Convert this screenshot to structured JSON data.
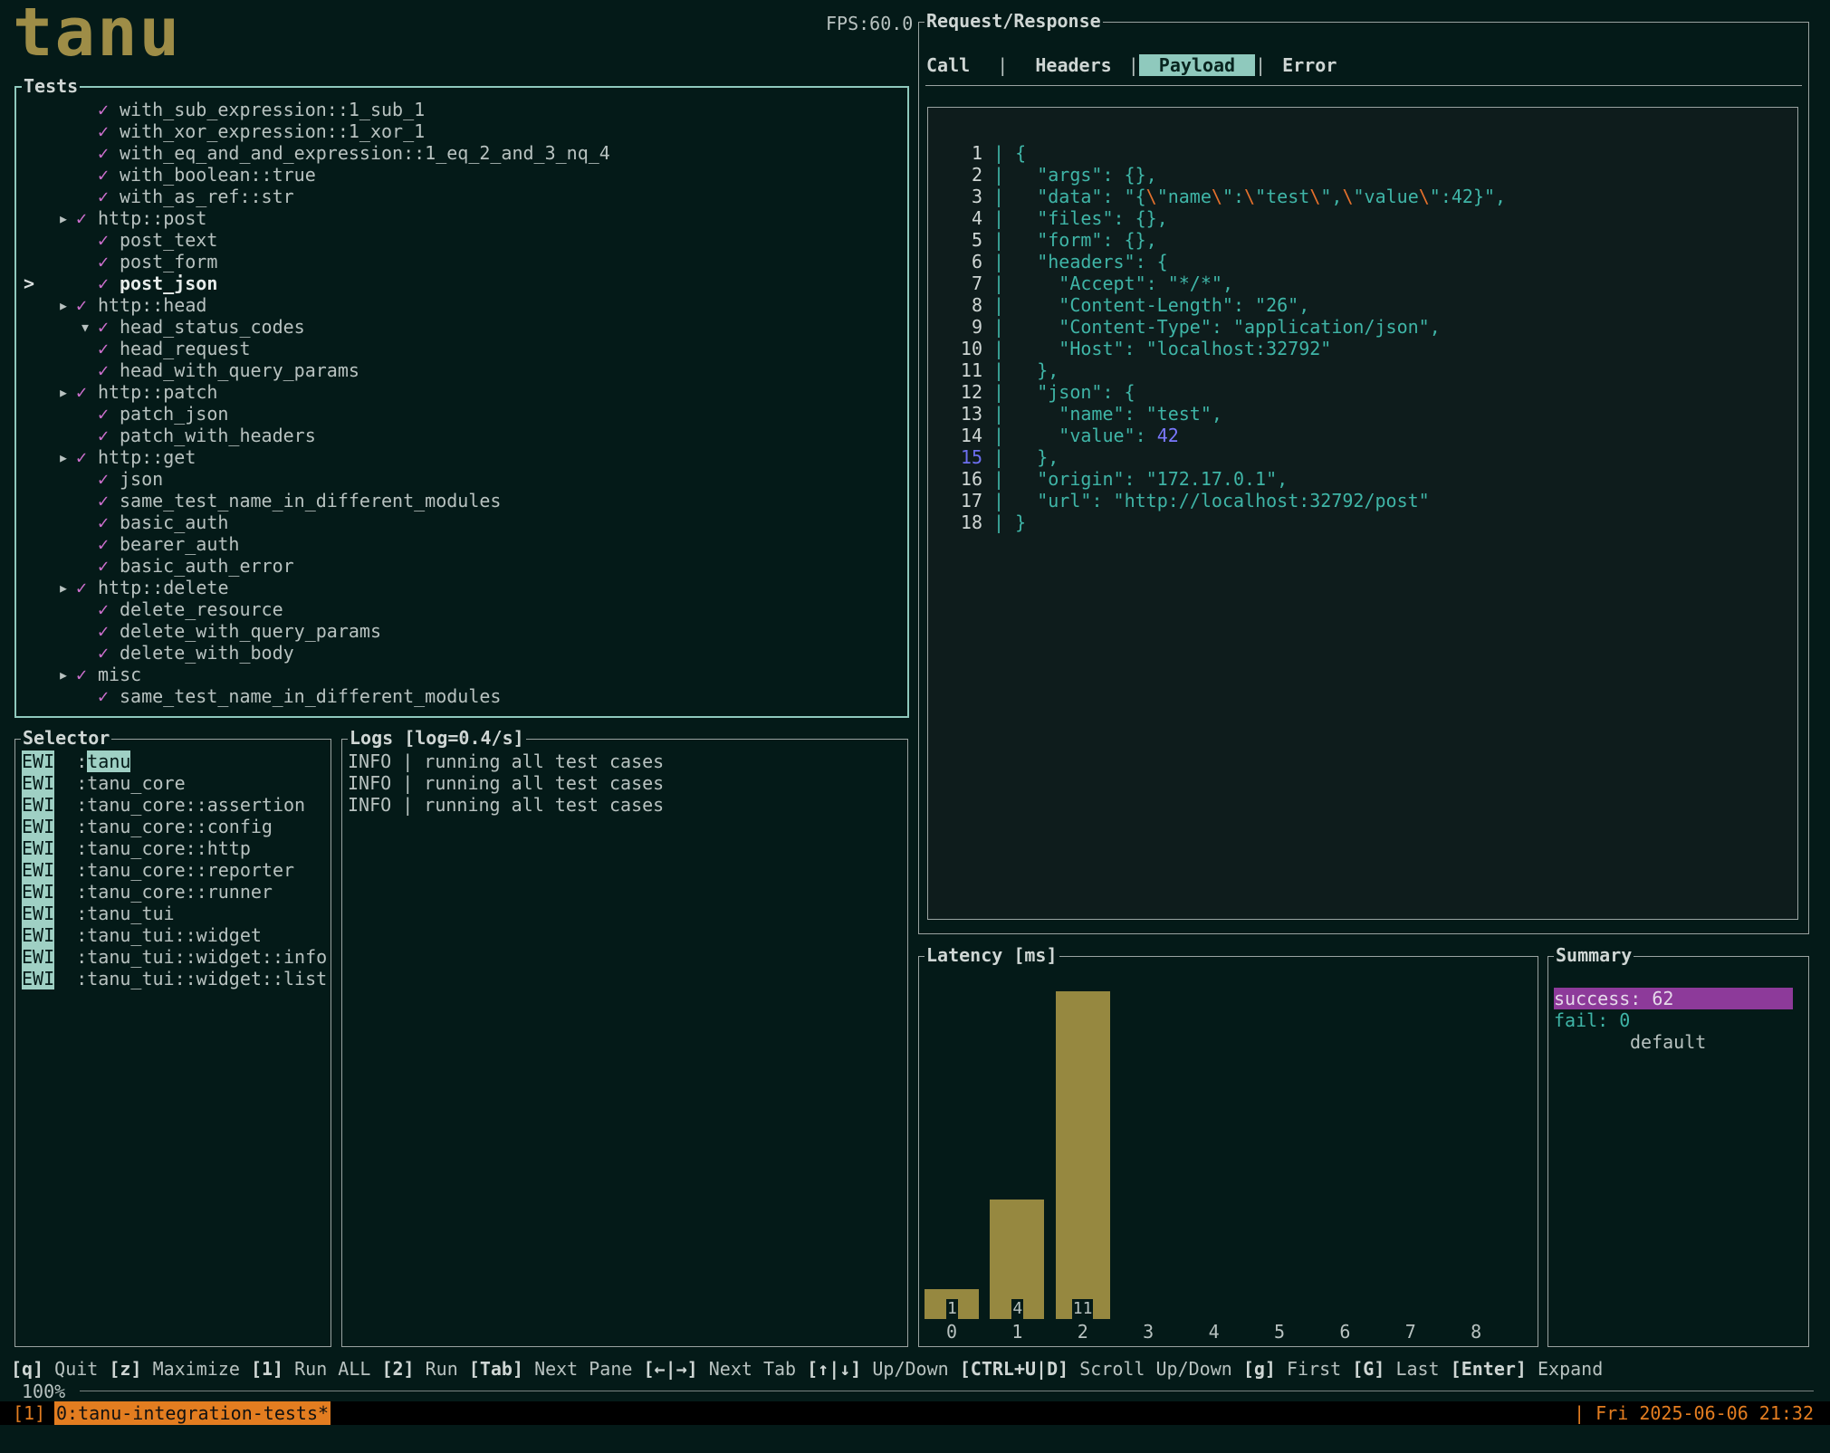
{
  "app": {
    "logo": "tanu",
    "fps": "FPS:60.0"
  },
  "tests": {
    "title": "Tests",
    "rows": [
      {
        "indent": 2,
        "caret": "",
        "check": "✓",
        "label": "with_sub_expression::1_sub_1"
      },
      {
        "indent": 2,
        "caret": "",
        "check": "✓",
        "label": "with_xor_expression::1_xor_1"
      },
      {
        "indent": 2,
        "caret": "",
        "check": "✓",
        "label": "with_eq_and_and_expression::1_eq_2_and_3_nq_4"
      },
      {
        "indent": 2,
        "caret": "",
        "check": "✓",
        "label": "with_boolean::true"
      },
      {
        "indent": 2,
        "caret": "",
        "check": "✓",
        "label": "with_as_ref::str"
      },
      {
        "indent": 1,
        "caret": "▸",
        "check": "✓",
        "label": "http::post"
      },
      {
        "indent": 2,
        "caret": "",
        "check": "✓",
        "label": "post_text"
      },
      {
        "indent": 2,
        "caret": "",
        "check": "✓",
        "label": "post_form"
      },
      {
        "indent": 2,
        "caret": "",
        "check": "✓",
        "label": "post_json",
        "selected": true,
        "marker": ">"
      },
      {
        "indent": 1,
        "caret": "▸",
        "check": "✓",
        "label": "http::head"
      },
      {
        "indent": 2,
        "caret": "▾",
        "check": "✓",
        "label": "head_status_codes"
      },
      {
        "indent": 2,
        "caret": "",
        "check": "✓",
        "label": "head_request"
      },
      {
        "indent": 2,
        "caret": "",
        "check": "✓",
        "label": "head_with_query_params"
      },
      {
        "indent": 1,
        "caret": "▸",
        "check": "✓",
        "label": "http::patch"
      },
      {
        "indent": 2,
        "caret": "",
        "check": "✓",
        "label": "patch_json"
      },
      {
        "indent": 2,
        "caret": "",
        "check": "✓",
        "label": "patch_with_headers"
      },
      {
        "indent": 1,
        "caret": "▸",
        "check": "✓",
        "label": "http::get"
      },
      {
        "indent": 2,
        "caret": "",
        "check": "✓",
        "label": "json"
      },
      {
        "indent": 2,
        "caret": "",
        "check": "✓",
        "label": "same_test_name_in_different_modules"
      },
      {
        "indent": 2,
        "caret": "",
        "check": "✓",
        "label": "basic_auth"
      },
      {
        "indent": 2,
        "caret": "",
        "check": "✓",
        "label": "bearer_auth"
      },
      {
        "indent": 2,
        "caret": "",
        "check": "✓",
        "label": "basic_auth_error"
      },
      {
        "indent": 1,
        "caret": "▸",
        "check": "✓",
        "label": "http::delete"
      },
      {
        "indent": 2,
        "caret": "",
        "check": "✓",
        "label": "delete_resource"
      },
      {
        "indent": 2,
        "caret": "",
        "check": "✓",
        "label": "delete_with_query_params"
      },
      {
        "indent": 2,
        "caret": "",
        "check": "✓",
        "label": "delete_with_body"
      },
      {
        "indent": 1,
        "caret": "▸",
        "check": "✓",
        "label": "misc"
      },
      {
        "indent": 2,
        "caret": "",
        "check": "✓",
        "label": "same_test_name_in_different_modules"
      }
    ]
  },
  "selector": {
    "title": "Selector",
    "badge": "EWI",
    "items": [
      {
        "prefix": ":",
        "name": "tanu",
        "highlight": true
      },
      {
        "prefix": ":",
        "name": "tanu_core"
      },
      {
        "prefix": ":",
        "name": "tanu_core::assertion"
      },
      {
        "prefix": ":",
        "name": "tanu_core::config"
      },
      {
        "prefix": ":",
        "name": "tanu_core::http"
      },
      {
        "prefix": ":",
        "name": "tanu_core::reporter"
      },
      {
        "prefix": ":",
        "name": "tanu_core::runner"
      },
      {
        "prefix": ":",
        "name": "tanu_tui"
      },
      {
        "prefix": ":",
        "name": "tanu_tui::widget"
      },
      {
        "prefix": ":",
        "name": "tanu_tui::widget::info"
      },
      {
        "prefix": ":",
        "name": "tanu_tui::widget::list"
      }
    ]
  },
  "logs": {
    "title": "Logs [log=0.4/s]",
    "lines": [
      "INFO | running all test cases",
      "INFO | running all test cases",
      "INFO | running all test cases"
    ]
  },
  "request_response": {
    "title": "Request/Response",
    "tabs": [
      "Call",
      "Headers",
      "Payload",
      "Error"
    ],
    "active_tab": "Payload",
    "current_line": 15,
    "code": [
      [
        {
          "t": "{",
          "c": "p"
        }
      ],
      [
        {
          "t": "  "
        },
        {
          "t": "\"args\"",
          "c": "k"
        },
        {
          "t": ": {},",
          "c": "p"
        }
      ],
      [
        {
          "t": "  "
        },
        {
          "t": "\"data\"",
          "c": "k"
        },
        {
          "t": ": \"{",
          "c": "p"
        },
        {
          "t": "\\",
          "c": "esc"
        },
        {
          "t": "\"name",
          "c": "s"
        },
        {
          "t": "\\",
          "c": "esc"
        },
        {
          "t": "\":",
          "c": "s"
        },
        {
          "t": "\\",
          "c": "esc"
        },
        {
          "t": "\"test",
          "c": "s"
        },
        {
          "t": "\\",
          "c": "esc"
        },
        {
          "t": "\",",
          "c": "s"
        },
        {
          "t": "\\",
          "c": "esc"
        },
        {
          "t": "\"value",
          "c": "s"
        },
        {
          "t": "\\",
          "c": "esc"
        },
        {
          "t": "\":42}\",",
          "c": "s"
        }
      ],
      [
        {
          "t": "  "
        },
        {
          "t": "\"files\"",
          "c": "k"
        },
        {
          "t": ": {},",
          "c": "p"
        }
      ],
      [
        {
          "t": "  "
        },
        {
          "t": "\"form\"",
          "c": "k"
        },
        {
          "t": ": {},",
          "c": "p"
        }
      ],
      [
        {
          "t": "  "
        },
        {
          "t": "\"headers\"",
          "c": "k"
        },
        {
          "t": ": {",
          "c": "p"
        }
      ],
      [
        {
          "t": "    "
        },
        {
          "t": "\"Accept\"",
          "c": "k"
        },
        {
          "t": ": ",
          "c": "p"
        },
        {
          "t": "\"*/*\"",
          "c": "s"
        },
        {
          "t": ",",
          "c": "p"
        }
      ],
      [
        {
          "t": "    "
        },
        {
          "t": "\"Content-Length\"",
          "c": "k"
        },
        {
          "t": ": ",
          "c": "p"
        },
        {
          "t": "\"26\"",
          "c": "s"
        },
        {
          "t": ",",
          "c": "p"
        }
      ],
      [
        {
          "t": "    "
        },
        {
          "t": "\"Content-Type\"",
          "c": "k"
        },
        {
          "t": ": ",
          "c": "p"
        },
        {
          "t": "\"application/json\"",
          "c": "s"
        },
        {
          "t": ",",
          "c": "p"
        }
      ],
      [
        {
          "t": "    "
        },
        {
          "t": "\"Host\"",
          "c": "k"
        },
        {
          "t": ": ",
          "c": "p"
        },
        {
          "t": "\"localhost:32792\"",
          "c": "s"
        }
      ],
      [
        {
          "t": "  "
        },
        {
          "t": "},",
          "c": "p"
        }
      ],
      [
        {
          "t": "  "
        },
        {
          "t": "\"json\"",
          "c": "k"
        },
        {
          "t": ": {",
          "c": "p"
        }
      ],
      [
        {
          "t": "    "
        },
        {
          "t": "\"name\"",
          "c": "k"
        },
        {
          "t": ": ",
          "c": "p"
        },
        {
          "t": "\"test\"",
          "c": "s"
        },
        {
          "t": ",",
          "c": "p"
        }
      ],
      [
        {
          "t": "    "
        },
        {
          "t": "\"value\"",
          "c": "k"
        },
        {
          "t": ": ",
          "c": "p"
        },
        {
          "t": "42",
          "c": "n"
        }
      ],
      [
        {
          "t": "  "
        },
        {
          "t": "},",
          "c": "p"
        }
      ],
      [
        {
          "t": "  "
        },
        {
          "t": "\"origin\"",
          "c": "k"
        },
        {
          "t": ": ",
          "c": "p"
        },
        {
          "t": "\"172.17.0.1\"",
          "c": "s"
        },
        {
          "t": ",",
          "c": "p"
        }
      ],
      [
        {
          "t": "  "
        },
        {
          "t": "\"url\"",
          "c": "k"
        },
        {
          "t": ": ",
          "c": "p"
        },
        {
          "t": "\"http://localhost:32792/post\"",
          "c": "s"
        }
      ],
      [
        {
          "t": "}",
          "c": "p"
        }
      ]
    ]
  },
  "latency": {
    "title": "Latency [ms]",
    "bars": [
      {
        "label": "0",
        "value": 1
      },
      {
        "label": "1",
        "value": 4
      },
      {
        "label": "2",
        "value": 11
      },
      {
        "label": "3",
        "value": 0
      },
      {
        "label": "4",
        "value": 0
      },
      {
        "label": "5",
        "value": 0
      },
      {
        "label": "6",
        "value": 0
      },
      {
        "label": "7",
        "value": 0
      },
      {
        "label": "8",
        "value": 0
      }
    ],
    "max": 11
  },
  "summary": {
    "title": "Summary",
    "success": "success: 62",
    "fail": "fail: 0",
    "profile": "default"
  },
  "help": {
    "keys": [
      {
        "key": "[q]",
        "desc": "Quit"
      },
      {
        "key": "[z]",
        "desc": "Maximize"
      },
      {
        "key": "[1]",
        "desc": "Run ALL"
      },
      {
        "key": "[2]",
        "desc": "Run"
      },
      {
        "key": "[Tab]",
        "desc": "Next Pane"
      },
      {
        "key": "[←|→]",
        "desc": "Next Tab"
      },
      {
        "key": "[↑|↓]",
        "desc": "Up/Down"
      },
      {
        "key": "[CTRL+U|D]",
        "desc": "Scroll Up/Down"
      },
      {
        "key": "[g]",
        "desc": "First"
      },
      {
        "key": "[G]",
        "desc": "Last"
      },
      {
        "key": "[Enter]",
        "desc": "Expand"
      }
    ]
  },
  "status": {
    "zoom": "100%",
    "window_index": "[1]",
    "window_name": "0:tanu-integration-tests*",
    "clock": "| Fri 2025-06-06 21:32"
  }
}
